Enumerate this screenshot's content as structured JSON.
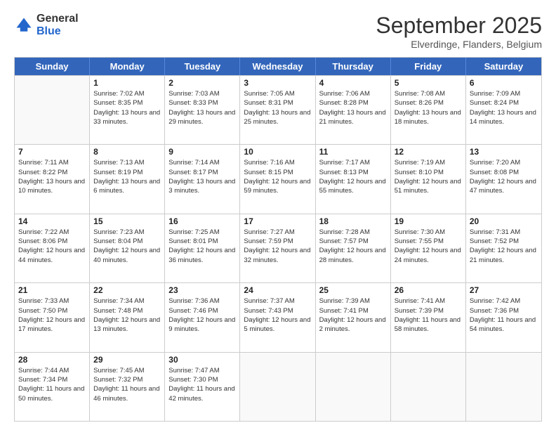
{
  "logo": {
    "general": "General",
    "blue": "Blue"
  },
  "header": {
    "month": "September 2025",
    "location": "Elverdinge, Flanders, Belgium"
  },
  "days_of_week": [
    "Sunday",
    "Monday",
    "Tuesday",
    "Wednesday",
    "Thursday",
    "Friday",
    "Saturday"
  ],
  "weeks": [
    [
      {
        "day": "",
        "empty": true
      },
      {
        "day": "1",
        "sunrise": "Sunrise: 7:02 AM",
        "sunset": "Sunset: 8:35 PM",
        "daylight": "Daylight: 13 hours and 33 minutes."
      },
      {
        "day": "2",
        "sunrise": "Sunrise: 7:03 AM",
        "sunset": "Sunset: 8:33 PM",
        "daylight": "Daylight: 13 hours and 29 minutes."
      },
      {
        "day": "3",
        "sunrise": "Sunrise: 7:05 AM",
        "sunset": "Sunset: 8:31 PM",
        "daylight": "Daylight: 13 hours and 25 minutes."
      },
      {
        "day": "4",
        "sunrise": "Sunrise: 7:06 AM",
        "sunset": "Sunset: 8:28 PM",
        "daylight": "Daylight: 13 hours and 21 minutes."
      },
      {
        "day": "5",
        "sunrise": "Sunrise: 7:08 AM",
        "sunset": "Sunset: 8:26 PM",
        "daylight": "Daylight: 13 hours and 18 minutes."
      },
      {
        "day": "6",
        "sunrise": "Sunrise: 7:09 AM",
        "sunset": "Sunset: 8:24 PM",
        "daylight": "Daylight: 13 hours and 14 minutes."
      }
    ],
    [
      {
        "day": "7",
        "sunrise": "Sunrise: 7:11 AM",
        "sunset": "Sunset: 8:22 PM",
        "daylight": "Daylight: 13 hours and 10 minutes."
      },
      {
        "day": "8",
        "sunrise": "Sunrise: 7:13 AM",
        "sunset": "Sunset: 8:19 PM",
        "daylight": "Daylight: 13 hours and 6 minutes."
      },
      {
        "day": "9",
        "sunrise": "Sunrise: 7:14 AM",
        "sunset": "Sunset: 8:17 PM",
        "daylight": "Daylight: 13 hours and 3 minutes."
      },
      {
        "day": "10",
        "sunrise": "Sunrise: 7:16 AM",
        "sunset": "Sunset: 8:15 PM",
        "daylight": "Daylight: 12 hours and 59 minutes."
      },
      {
        "day": "11",
        "sunrise": "Sunrise: 7:17 AM",
        "sunset": "Sunset: 8:13 PM",
        "daylight": "Daylight: 12 hours and 55 minutes."
      },
      {
        "day": "12",
        "sunrise": "Sunrise: 7:19 AM",
        "sunset": "Sunset: 8:10 PM",
        "daylight": "Daylight: 12 hours and 51 minutes."
      },
      {
        "day": "13",
        "sunrise": "Sunrise: 7:20 AM",
        "sunset": "Sunset: 8:08 PM",
        "daylight": "Daylight: 12 hours and 47 minutes."
      }
    ],
    [
      {
        "day": "14",
        "sunrise": "Sunrise: 7:22 AM",
        "sunset": "Sunset: 8:06 PM",
        "daylight": "Daylight: 12 hours and 44 minutes."
      },
      {
        "day": "15",
        "sunrise": "Sunrise: 7:23 AM",
        "sunset": "Sunset: 8:04 PM",
        "daylight": "Daylight: 12 hours and 40 minutes."
      },
      {
        "day": "16",
        "sunrise": "Sunrise: 7:25 AM",
        "sunset": "Sunset: 8:01 PM",
        "daylight": "Daylight: 12 hours and 36 minutes."
      },
      {
        "day": "17",
        "sunrise": "Sunrise: 7:27 AM",
        "sunset": "Sunset: 7:59 PM",
        "daylight": "Daylight: 12 hours and 32 minutes."
      },
      {
        "day": "18",
        "sunrise": "Sunrise: 7:28 AM",
        "sunset": "Sunset: 7:57 PM",
        "daylight": "Daylight: 12 hours and 28 minutes."
      },
      {
        "day": "19",
        "sunrise": "Sunrise: 7:30 AM",
        "sunset": "Sunset: 7:55 PM",
        "daylight": "Daylight: 12 hours and 24 minutes."
      },
      {
        "day": "20",
        "sunrise": "Sunrise: 7:31 AM",
        "sunset": "Sunset: 7:52 PM",
        "daylight": "Daylight: 12 hours and 21 minutes."
      }
    ],
    [
      {
        "day": "21",
        "sunrise": "Sunrise: 7:33 AM",
        "sunset": "Sunset: 7:50 PM",
        "daylight": "Daylight: 12 hours and 17 minutes."
      },
      {
        "day": "22",
        "sunrise": "Sunrise: 7:34 AM",
        "sunset": "Sunset: 7:48 PM",
        "daylight": "Daylight: 12 hours and 13 minutes."
      },
      {
        "day": "23",
        "sunrise": "Sunrise: 7:36 AM",
        "sunset": "Sunset: 7:46 PM",
        "daylight": "Daylight: 12 hours and 9 minutes."
      },
      {
        "day": "24",
        "sunrise": "Sunrise: 7:37 AM",
        "sunset": "Sunset: 7:43 PM",
        "daylight": "Daylight: 12 hours and 5 minutes."
      },
      {
        "day": "25",
        "sunrise": "Sunrise: 7:39 AM",
        "sunset": "Sunset: 7:41 PM",
        "daylight": "Daylight: 12 hours and 2 minutes."
      },
      {
        "day": "26",
        "sunrise": "Sunrise: 7:41 AM",
        "sunset": "Sunset: 7:39 PM",
        "daylight": "Daylight: 11 hours and 58 minutes."
      },
      {
        "day": "27",
        "sunrise": "Sunrise: 7:42 AM",
        "sunset": "Sunset: 7:36 PM",
        "daylight": "Daylight: 11 hours and 54 minutes."
      }
    ],
    [
      {
        "day": "28",
        "sunrise": "Sunrise: 7:44 AM",
        "sunset": "Sunset: 7:34 PM",
        "daylight": "Daylight: 11 hours and 50 minutes."
      },
      {
        "day": "29",
        "sunrise": "Sunrise: 7:45 AM",
        "sunset": "Sunset: 7:32 PM",
        "daylight": "Daylight: 11 hours and 46 minutes."
      },
      {
        "day": "30",
        "sunrise": "Sunrise: 7:47 AM",
        "sunset": "Sunset: 7:30 PM",
        "daylight": "Daylight: 11 hours and 42 minutes."
      },
      {
        "day": "",
        "empty": true
      },
      {
        "day": "",
        "empty": true
      },
      {
        "day": "",
        "empty": true
      },
      {
        "day": "",
        "empty": true
      }
    ]
  ]
}
